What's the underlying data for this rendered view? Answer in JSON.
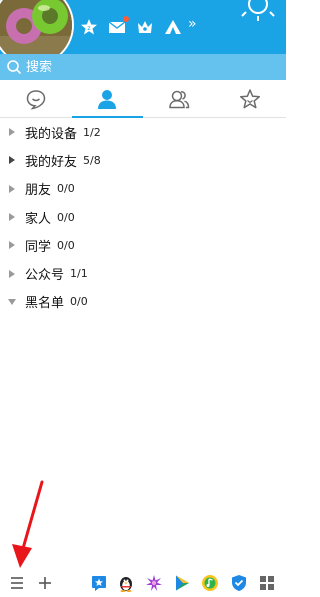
{
  "header": {
    "icons": [
      "qzone-star-icon",
      "mail-icon",
      "crown-icon",
      "tent-icon"
    ],
    "more_glyph": "»",
    "colors": {
      "background": "#1aa3e5",
      "notification_dot": "#ff5b3a"
    }
  },
  "search": {
    "placeholder": "搜索",
    "background": "#65c1ee"
  },
  "tabs": [
    {
      "icon": "chat-bubble-icon",
      "active": false
    },
    {
      "icon": "contact-person-icon",
      "active": true
    },
    {
      "icon": "group-people-icon",
      "active": false
    },
    {
      "icon": "star-icon",
      "active": false
    }
  ],
  "groups": [
    {
      "name": "我的设备",
      "count": "1/2",
      "expanded": false
    },
    {
      "name": "我的好友",
      "count": "5/8",
      "expanded": false
    },
    {
      "name": "朋友",
      "count": "0/0",
      "expanded": false
    },
    {
      "name": "家人",
      "count": "0/0",
      "expanded": false
    },
    {
      "name": "同学",
      "count": "0/0",
      "expanded": false
    },
    {
      "name": "公众号",
      "count": "1/1",
      "expanded": false
    },
    {
      "name": "黑名单",
      "count": "0/0",
      "expanded": true
    }
  ],
  "bottom_bar": {
    "left": [
      "menu-icon",
      "add-icon"
    ],
    "apps": [
      "app-store-icon",
      "penguin-game-icon",
      "flower-app-icon",
      "video-play-icon",
      "music-icon",
      "shield-icon",
      "grid-apps-icon"
    ]
  },
  "accent_color": "#1aa3e5",
  "annotation_color": "#e8161b"
}
